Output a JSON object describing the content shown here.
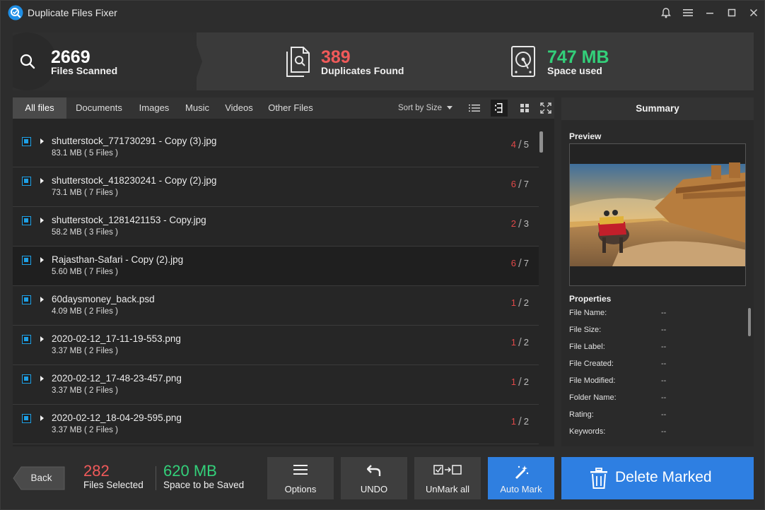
{
  "window": {
    "title": "Duplicate Files Fixer",
    "controls": [
      "bell-icon",
      "menu-icon",
      "minimize-icon",
      "maximize-icon",
      "close-icon"
    ]
  },
  "stats": {
    "scanned": {
      "value": "2669",
      "label": "Files Scanned",
      "color": "#ffffff"
    },
    "duplicates": {
      "value": "389",
      "label": "Duplicates Found",
      "color": "#f05a5a"
    },
    "space": {
      "value": "747 MB",
      "label": "Space used",
      "color": "#33d07a"
    }
  },
  "tabs": [
    {
      "label": "All files",
      "active": true
    },
    {
      "label": "Documents"
    },
    {
      "label": "Images"
    },
    {
      "label": "Music"
    },
    {
      "label": "Videos"
    },
    {
      "label": "Other Files"
    }
  ],
  "sort": {
    "label": "Sort by Size"
  },
  "files": [
    {
      "name": "shutterstock_771730291 - Copy (3).jpg",
      "size": "83.1 MB",
      "group": "( 5 Files )",
      "marked": "4",
      "total": "5"
    },
    {
      "name": "shutterstock_418230241 - Copy (2).jpg",
      "size": "73.1 MB",
      "group": "( 7 Files )",
      "marked": "6",
      "total": "7"
    },
    {
      "name": "shutterstock_1281421153 - Copy.jpg",
      "size": "58.2 MB",
      "group": "( 3 Files )",
      "marked": "2",
      "total": "3"
    },
    {
      "name": "Rajasthan-Safari - Copy (2).jpg",
      "size": "5.60 MB",
      "group": "( 7 Files )",
      "marked": "6",
      "total": "7"
    },
    {
      "name": "60daysmoney_back.psd",
      "size": "4.09 MB",
      "group": "( 2 Files )",
      "marked": "1",
      "total": "2"
    },
    {
      "name": "2020-02-12_17-11-19-553.png",
      "size": "3.37 MB",
      "group": "( 2 Files )",
      "marked": "1",
      "total": "2"
    },
    {
      "name": "2020-02-12_17-48-23-457.png",
      "size": "3.37 MB",
      "group": "( 2 Files )",
      "marked": "1",
      "total": "2"
    },
    {
      "name": "2020-02-12_18-04-29-595.png",
      "size": "3.37 MB",
      "group": "( 2 Files )",
      "marked": "1",
      "total": "2"
    }
  ],
  "summary": {
    "title": "Summary",
    "preview_label": "Preview",
    "properties_title": "Properties",
    "properties": [
      {
        "label": "File Name:",
        "value": "--"
      },
      {
        "label": "File Size:",
        "value": "--"
      },
      {
        "label": "File Label:",
        "value": "--"
      },
      {
        "label": "File Created:",
        "value": "--"
      },
      {
        "label": "File Modified:",
        "value": "--"
      },
      {
        "label": "Folder Name:",
        "value": "--"
      },
      {
        "label": "Rating:",
        "value": "--"
      },
      {
        "label": "Keywords:",
        "value": "--"
      }
    ]
  },
  "bottom": {
    "back_label": "Back",
    "files_selected": {
      "value": "282",
      "label": "Files Selected",
      "color": "#f05a5a"
    },
    "space_saved": {
      "value": "620 MB",
      "label": "Space to be Saved",
      "color": "#33d07a"
    },
    "buttons": {
      "options": "Options",
      "undo": "UNDO",
      "unmark": "UnMark all",
      "automark": "Auto Mark",
      "delete": "Delete Marked"
    }
  }
}
